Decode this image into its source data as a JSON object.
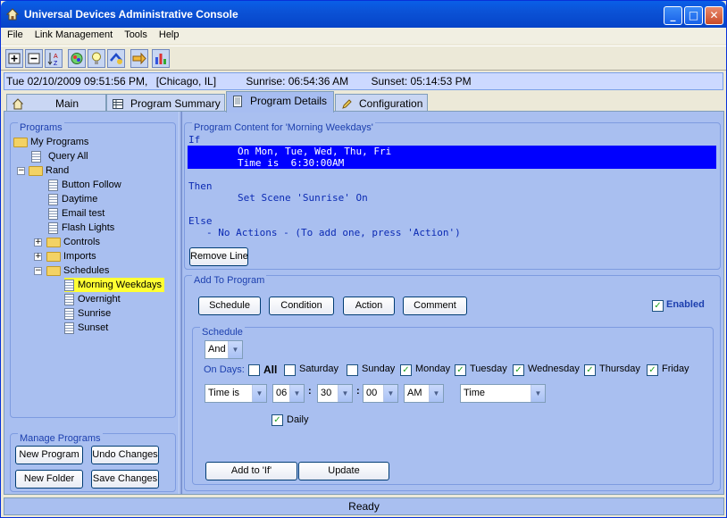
{
  "window": {
    "title": "Universal Devices Administrative Console"
  },
  "menu": [
    "File",
    "Link Management",
    "Tools",
    "Help"
  ],
  "toolbar": {
    "icons": [
      "expand-all-icon",
      "collapse-all-icon",
      "sort-az-icon",
      "network-icon",
      "bulb-icon",
      "link-icon",
      "arrow-icon",
      "chart-icon"
    ]
  },
  "status": {
    "datetime": "Tue 02/10/2009 09:51:56 PM,",
    "location": "[Chicago, IL]",
    "sunrise": "Sunrise: 06:54:36 AM",
    "sunset": "Sunset: 05:14:53 PM"
  },
  "tabs": [
    "Main",
    "Program Summary",
    "Program Details",
    "Configuration"
  ],
  "programs": {
    "label": "Programs",
    "tree": {
      "root": "My Programs",
      "query_all": "Query All",
      "rand": "Rand",
      "items": [
        "Button Follow",
        "Daytime",
        "Email test",
        "Flash Lights"
      ],
      "controls": "Controls",
      "imports": "Imports",
      "schedules": "Schedules",
      "schedule_items": [
        "Morning Weekdays",
        "Overnight",
        "Sunrise",
        "Sunset"
      ]
    }
  },
  "manage": {
    "label": "Manage Programs",
    "new_program": "New Program",
    "undo_changes": "Undo Changes",
    "new_folder": "New Folder",
    "save_changes": "Save Changes"
  },
  "content": {
    "label": "Program Content for 'Morning Weekdays'",
    "if": "If",
    "cond1": "On Mon, Tue, Wed, Thu, Fri",
    "cond2": "Time is  6:30:00AM",
    "then": "Then",
    "action": "Set Scene 'Sunrise' On",
    "else": "Else",
    "else_action": "- No Actions - (To add one, press 'Action')",
    "remove_line": "Remove Line"
  },
  "add": {
    "label": "Add To Program",
    "schedule": "Schedule",
    "condition": "Condition",
    "action": "Action",
    "comment": "Comment",
    "enabled": "Enabled"
  },
  "schedule": {
    "label": "Schedule",
    "logic": "And",
    "on_days": "On Days:",
    "all": "All",
    "days": [
      "Saturday",
      "Sunday",
      "Monday",
      "Tuesday",
      "Wednesday",
      "Thursday",
      "Friday"
    ],
    "days_checked": [
      false,
      false,
      true,
      true,
      true,
      true,
      true
    ],
    "time_mode": "Time is",
    "hour": "06",
    "minute": "30",
    "second": "00",
    "ampm": "AM",
    "time_type": "Time",
    "sep": ":",
    "daily": "Daily",
    "add_to_if": "Add to 'If'",
    "update": "Update"
  },
  "footer": {
    "status": "Ready"
  },
  "colors": {
    "highlight": "#0000ff",
    "selected_tree": "#ffff33",
    "code": "#0b2ab3"
  }
}
